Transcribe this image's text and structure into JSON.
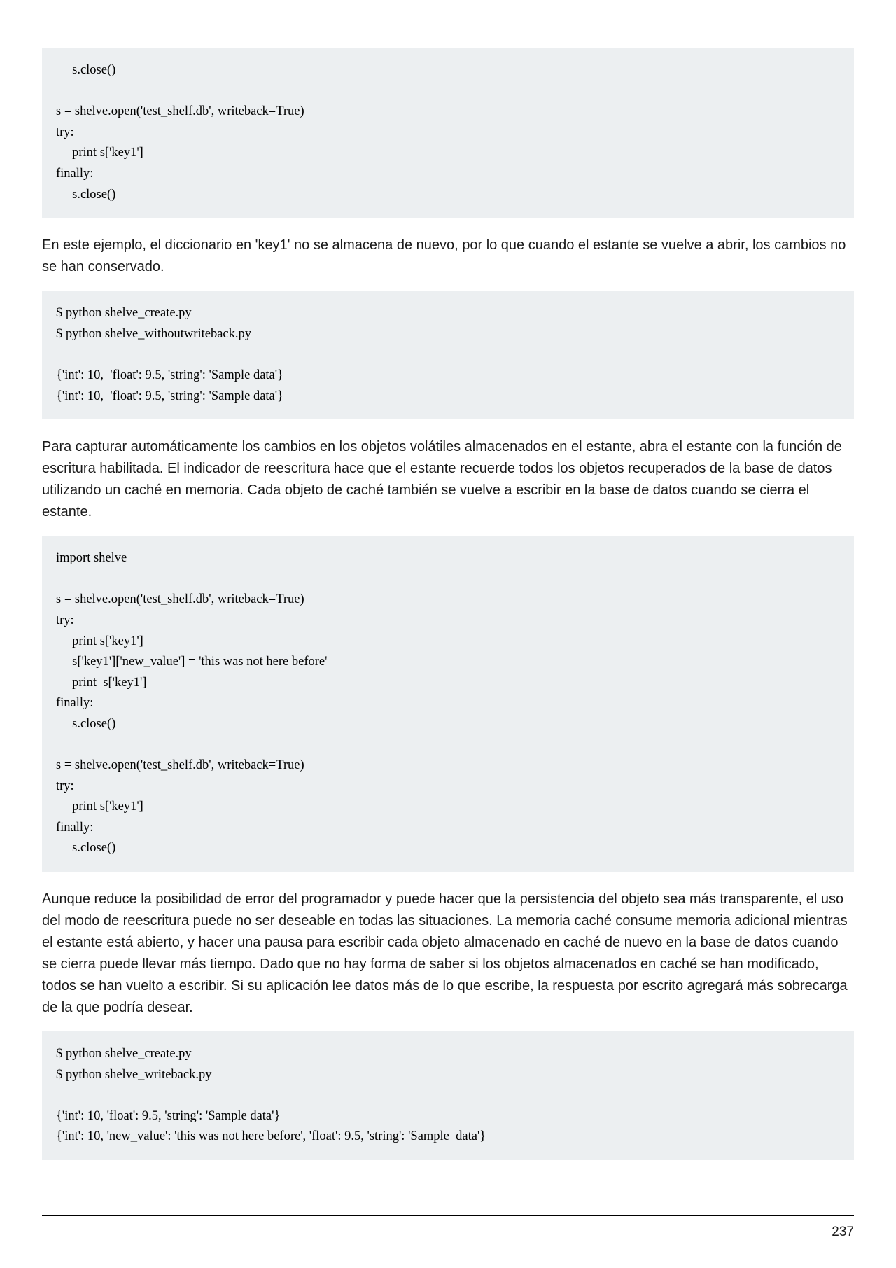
{
  "code_block_1": "     s.close()\n\ns = shelve.open('test_shelf.db', writeback=True)\ntry:\n     print s['key1']\nfinally:\n     s.close()",
  "para_1": "En este ejemplo, el diccionario en 'key1' no se almacena de nuevo, por lo que cuando el estante se vuelve a abrir, los cambios no se han conservado.",
  "code_block_2": "$ python shelve_create.py\n$ python shelve_withoutwriteback.py\n\n{'int': 10,  'float': 9.5, 'string': 'Sample data'}\n{'int': 10,  'float': 9.5, 'string': 'Sample data'}",
  "para_2": "Para capturar automáticamente los cambios en los objetos volátiles almacenados en el estante, abra el estante con la función de escritura habilitada. El indicador de reescritura hace que el estante recuerde todos los objetos recuperados de la base de datos utilizando un caché en memoria. Cada objeto de caché también se vuelve a escribir en la base de datos cuando se cierra el estante.",
  "code_block_3": "import shelve\n\ns = shelve.open('test_shelf.db', writeback=True)\ntry:\n     print s['key1']\n     s['key1']['new_value'] = 'this was not here before'\n     print  s['key1']\nfinally:\n     s.close()\n\ns = shelve.open('test_shelf.db', writeback=True)\ntry:\n     print s['key1']\nfinally:\n     s.close()",
  "para_3": "Aunque reduce la posibilidad de error del programador y puede hacer que la persistencia del objeto sea más transparente, el uso del modo de reescritura puede no ser deseable en todas las situaciones. La memoria caché consume memoria adicional mientras el estante está abierto, y hacer una pausa para escribir cada objeto almacenado en caché de nuevo en la base de datos cuando se cierra puede llevar más tiempo. Dado que no hay forma de saber si los objetos almacenados en caché se han modificado, todos se han vuelto a escribir. Si su aplicación lee datos más de lo que escribe, la respuesta por escrito agregará más sobrecarga de la que podría desear.",
  "code_block_4": "$ python shelve_create.py\n$ python shelve_writeback.py\n\n{'int': 10, 'float': 9.5, 'string': 'Sample data'}\n{'int': 10, 'new_value': 'this was not here before', 'float': 9.5, 'string': 'Sample  data'}",
  "page_number": "237"
}
